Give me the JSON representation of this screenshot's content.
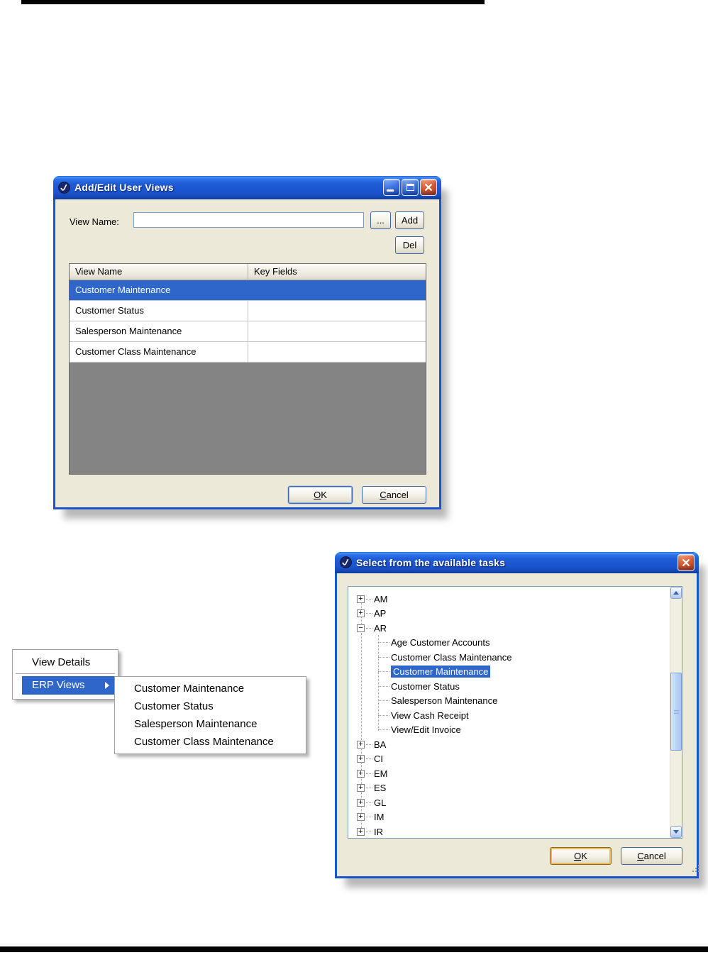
{
  "dialog1": {
    "title": "Add/Edit User Views",
    "view_name_label": "View Name:",
    "view_name_value": "",
    "browse_button": "...",
    "add_button": "Add",
    "del_button": "Del",
    "table": {
      "columns": [
        "View Name",
        "Key Fields"
      ],
      "rows": [
        {
          "view_name": "Customer Maintenance",
          "key_fields": "",
          "selected": true
        },
        {
          "view_name": "Customer Status",
          "key_fields": "",
          "selected": false
        },
        {
          "view_name": "Salesperson Maintenance",
          "key_fields": "",
          "selected": false
        },
        {
          "view_name": "Customer Class Maintenance",
          "key_fields": "",
          "selected": false
        }
      ]
    },
    "ok_button": "OK",
    "cancel_button": "Cancel"
  },
  "context_menu": {
    "items": [
      {
        "label": "View Details",
        "selected": false,
        "has_submenu": false
      },
      {
        "label": "ERP Views",
        "selected": true,
        "has_submenu": true
      }
    ],
    "submenu_items": [
      "Customer Maintenance",
      "Customer Status",
      "Salesperson Maintenance",
      "Customer Class Maintenance"
    ]
  },
  "dialog2": {
    "title": "Select from the available tasks",
    "tree": [
      {
        "label": "AM",
        "expander": "plus",
        "level": 0,
        "selected": false
      },
      {
        "label": "AP",
        "expander": "plus",
        "level": 0,
        "selected": false
      },
      {
        "label": "AR",
        "expander": "minus",
        "level": 0,
        "selected": false
      },
      {
        "label": "Age Customer Accounts",
        "level": 1,
        "selected": false
      },
      {
        "label": "Customer Class Maintenance",
        "level": 1,
        "selected": false
      },
      {
        "label": "Customer Maintenance",
        "level": 1,
        "selected": true
      },
      {
        "label": "Customer Status",
        "level": 1,
        "selected": false
      },
      {
        "label": "Salesperson Maintenance",
        "level": 1,
        "selected": false
      },
      {
        "label": "View Cash Receipt",
        "level": 1,
        "selected": false
      },
      {
        "label": "View/Edit Invoice",
        "level": 1,
        "selected": false
      },
      {
        "label": "BA",
        "expander": "plus",
        "level": 0,
        "selected": false
      },
      {
        "label": "CI",
        "expander": "plus",
        "level": 0,
        "selected": false
      },
      {
        "label": "EM",
        "expander": "plus",
        "level": 0,
        "selected": false
      },
      {
        "label": "ES",
        "expander": "plus",
        "level": 0,
        "selected": false
      },
      {
        "label": "GL",
        "expander": "plus",
        "level": 0,
        "selected": false
      },
      {
        "label": "IM",
        "expander": "plus",
        "level": 0,
        "selected": false
      },
      {
        "label": "IR",
        "expander": "plus",
        "level": 0,
        "selected": false
      }
    ],
    "ok_button": "OK",
    "cancel_button": "Cancel"
  },
  "icons": {
    "app_icon": "swirl-logo",
    "minimize": "minimize-icon",
    "maximize": "maximize-icon",
    "close": "close-icon",
    "submenu_arrow": "right-arrow",
    "expand": "plus",
    "collapse": "minus",
    "scroll_up": "up-arrow",
    "scroll_down": "down-arrow"
  },
  "colors": {
    "titlebar_blue": "#1b54cf",
    "selection_blue": "#2f66c9",
    "client_beige": "#ece9d8",
    "table_filler_gray": "#848484",
    "close_button_red": "#cc3c12",
    "ok_focus_gold": "#f0b95c"
  }
}
